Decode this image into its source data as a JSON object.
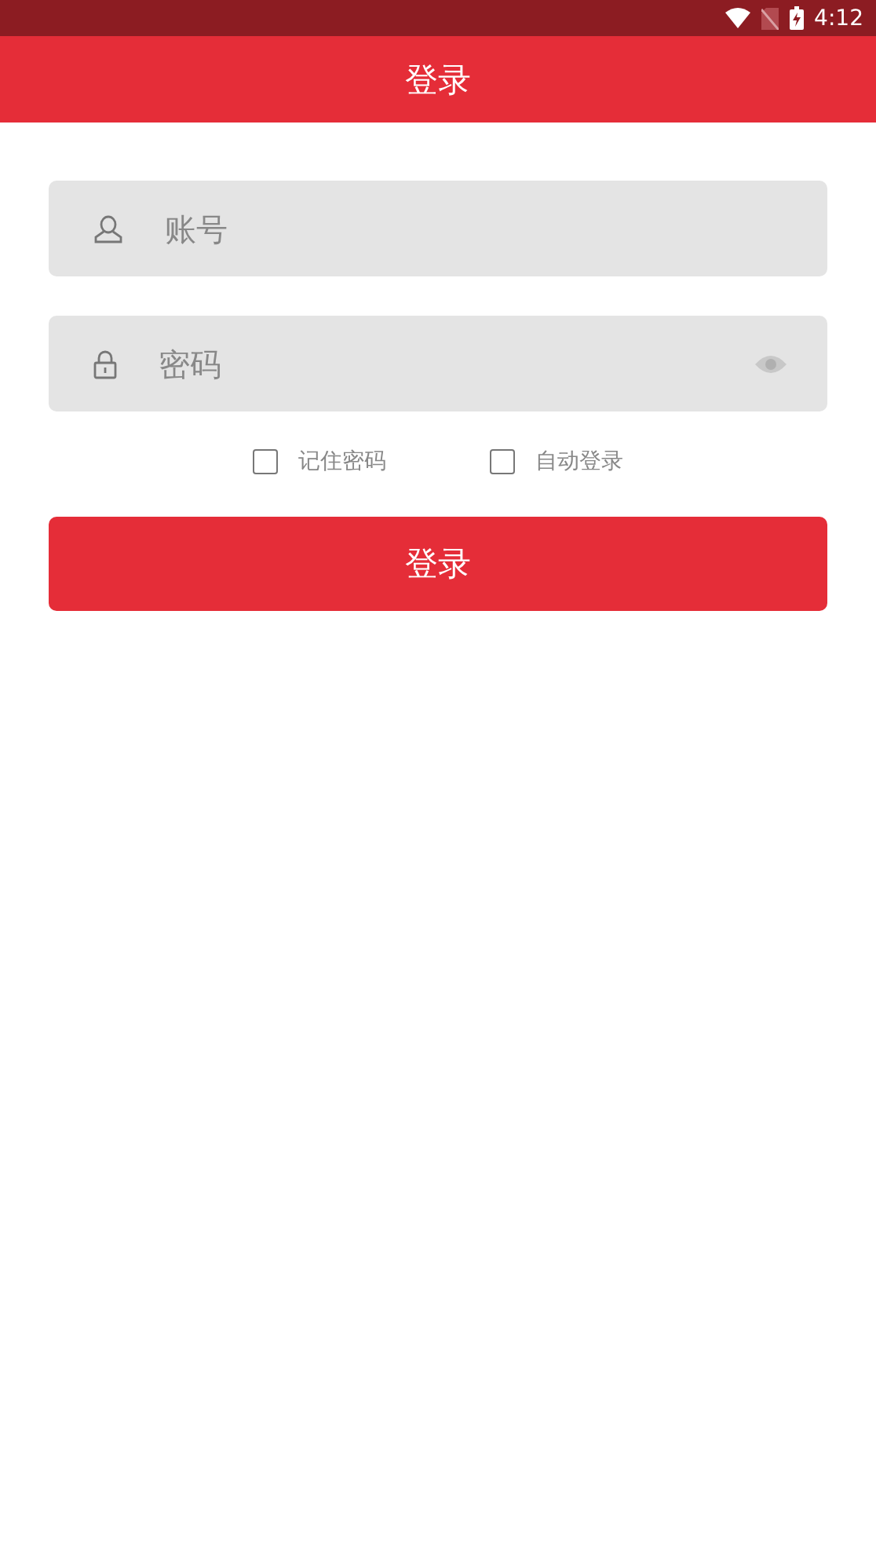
{
  "status_bar": {
    "time": "4:12"
  },
  "header": {
    "title": "登录"
  },
  "fields": [
    {
      "kind": "account",
      "placeholder": "账号"
    },
    {
      "kind": "password",
      "placeholder": "密码"
    }
  ],
  "options": [
    {
      "label": "记住密码",
      "checked": false
    },
    {
      "label": "自动登录",
      "checked": false
    }
  ],
  "login_button": "登录"
}
